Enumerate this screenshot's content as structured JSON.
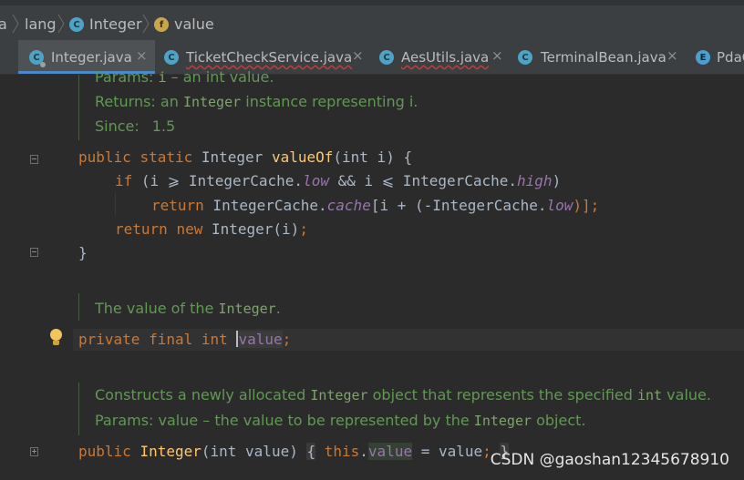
{
  "breadcrumb": {
    "items": [
      {
        "label": "a",
        "icon": null
      },
      {
        "label": "lang",
        "icon": null
      },
      {
        "label": "Integer",
        "icon": "class-icon"
      },
      {
        "label": "value",
        "icon": "field-icon"
      }
    ],
    "class_icon_letter": "C",
    "field_icon_letter": "f"
  },
  "tabs": [
    {
      "label": "Integer.java",
      "close": "×",
      "active": true
    },
    {
      "label": "TicketCheckService.java",
      "close": "×",
      "active": false
    },
    {
      "label": "AesUtils.java",
      "close": "×",
      "active": false
    },
    {
      "label": "TerminalBean.java",
      "close": "×",
      "active": false
    },
    {
      "label": "PdaC",
      "close": "",
      "active": false
    }
  ],
  "tab_icon_letters": {
    "class": "C",
    "enum": "E"
  },
  "editor": {
    "doc1": {
      "params": {
        "pre": "Params: ",
        "code": "i",
        "post": " – an int value."
      },
      "returns": {
        "pre": "Returns: an ",
        "code": "Integer",
        "post": " instance representing i."
      },
      "since": {
        "pre": "Since:",
        "value": "1.5"
      }
    },
    "code1": {
      "line1": {
        "kw1": "public",
        "kw2": "static",
        "type": "Integer",
        "name": "valueOf",
        "params": "(int i) {"
      },
      "line2": {
        "kw": "if",
        "text": " (i ⩾ IntegerCache.",
        "f1": "low",
        "mid": " && i ⩽ IntegerCache.",
        "f2": "high",
        "end": ")"
      },
      "line3": {
        "kw": "return",
        "text": " IntegerCache.",
        "f1": "cache",
        "mid": "[i + (-IntegerCache.",
        "f2": "low",
        "end": ")];"
      },
      "line4": {
        "kw1": "return",
        "kw2": "new",
        "text": " Integer(i)",
        "end": ";"
      },
      "line5": "}"
    },
    "doc2": {
      "pre": "The value of the ",
      "code": "Integer",
      "post": "."
    },
    "field_line": {
      "kw1": "private",
      "kw2": "final",
      "kw3": "int",
      "name": "value",
      "end": ";"
    },
    "doc3": {
      "line1": {
        "pre": "Constructs a newly allocated ",
        "code": "Integer",
        "mid": " object that represents the specified ",
        "code2": "int",
        "post": " value."
      },
      "line2": {
        "pre": "Params: value – the value to be represented by the ",
        "code": "Integer",
        "post": " object."
      }
    },
    "ctor_line": {
      "kw": "public",
      "name": "Integer",
      "params": "(int value) ",
      "brace_open": "{",
      "this": "this",
      "field": "value",
      "rest": " = value",
      "semi": ";",
      "brace_close": "}"
    }
  },
  "watermark": "CSDN @gaoshan12345678910",
  "colors": {
    "background": "#2b2b2b",
    "keyword": "#cc7832",
    "method": "#ffc66d",
    "field": "#9876aa",
    "doc": "#629755",
    "tab_active_underline": "#4a88c7"
  }
}
